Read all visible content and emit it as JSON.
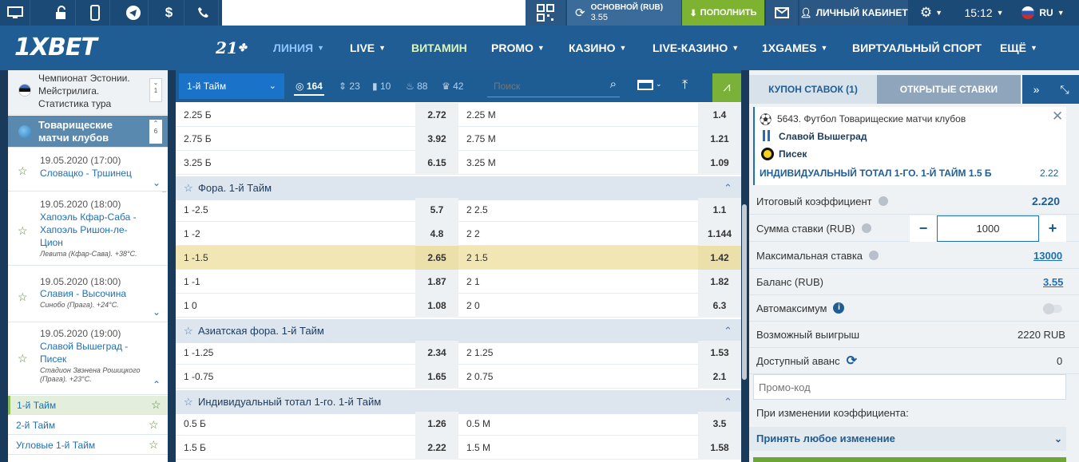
{
  "topbar": {
    "account_label": "ОСНОВНОЙ (RUB)",
    "account_amount": "3.55",
    "deposit": "ПОПОЛНИТЬ",
    "cabinet": "ЛИЧНЫЙ КАБИНЕТ",
    "time": "15:12",
    "lang": "RU"
  },
  "logo": "1XBET",
  "nav": {
    "n21": "21",
    "liniya": "ЛИНИЯ",
    "live": "LIVE",
    "vitamin": "ВИТАМИН",
    "promo": "PROMO",
    "casino": "КАЗИНО",
    "livecasino": "LIVE-КАЗИНО",
    "xgames": "1XGAMES",
    "virtual": "ВИРТУАЛЬНЫЙ СПОРТ",
    "more": "ЕЩЁ"
  },
  "left": {
    "top_title": "Чемпионат Эстонии. Мейстрилига. Статистика тура",
    "top_count": "1",
    "league": "Товарищеские матчи клубов",
    "league_count": "6",
    "matches": [
      {
        "time": "19.05.2020 (17:00)",
        "teams": "Словацко - Тршинец",
        "info": ""
      },
      {
        "time": "19.05.2020 (18:00)",
        "teams": "Хапоэль Кфар-Саба - Хапоэль Ришон-ле-Цион",
        "info": "Левита (Кфар-Сава). +38°C."
      },
      {
        "time": "19.05.2020 (18:00)",
        "teams": "Славия - Высочина",
        "info": "Синобо (Прага). +24°C."
      },
      {
        "time": "19.05.2020 (19:00)",
        "teams": "Славой Вышеград - Писек",
        "info": "Стадион Звэнена Рошицкого (Прага). +23°C."
      }
    ],
    "periods": [
      "1-й Тайм",
      "2-й Тайм",
      "Угловые 1-й Тайм"
    ]
  },
  "center": {
    "select": "1-й Тайм",
    "c164": "164",
    "c23": "23",
    "c10": "10",
    "c88": "88",
    "c42": "42",
    "search_placeholder": "Поиск",
    "rows_a": [
      [
        "2.25 Б",
        "2.72",
        "2.25 М",
        "1.4"
      ],
      [
        "2.75 Б",
        "3.92",
        "2.75 М",
        "1.21"
      ],
      [
        "3.25 Б",
        "6.15",
        "3.25 М",
        "1.09"
      ]
    ],
    "sec1": "Фора. 1-й Тайм",
    "rows_b": [
      [
        "1 -2.5",
        "5.7",
        "2 2.5",
        "1.1"
      ],
      [
        "1 -2",
        "4.8",
        "2 2",
        "1.144"
      ],
      [
        "1 -1.5",
        "2.65",
        "2 1.5",
        "1.42"
      ],
      [
        "1 -1",
        "1.87",
        "2 1",
        "1.82"
      ],
      [
        "1 0",
        "1.08",
        "2 0",
        "6.3"
      ]
    ],
    "sec2": "Азиатская фора. 1-й Тайм",
    "rows_c": [
      [
        "1 -1.25",
        "2.34",
        "2 1.25",
        "1.53"
      ],
      [
        "1 -0.75",
        "1.65",
        "2 0.75",
        "2.1"
      ]
    ],
    "sec3": "Индивидуальный тотал 1-го. 1-й Тайм",
    "rows_d": [
      [
        "0.5 Б",
        "1.26",
        "0.5 М",
        "3.5"
      ],
      [
        "1.5 Б",
        "2.22",
        "1.5 М",
        "1.58"
      ]
    ]
  },
  "coupon": {
    "tab1": "КУПОН СТАВОК (1)",
    "tab2": "ОТКРЫТЫЕ СТАВКИ",
    "event": "5643. Футбол Товарищеские матчи клубов",
    "team1": "Славой Вышеград",
    "team2": "Писек",
    "bet": "ИНДИВИДУАЛЬНЫЙ ТОТАЛ 1-ГО. 1-Й ТАЙМ  1.5 Б",
    "bet_odd": "2.22",
    "total_label": "Итоговый коэффициент",
    "total": "2.220",
    "stake_label": "Сумма ставки (RUB)",
    "stake": "1000",
    "max_label": "Максимальная ставка",
    "max": "13000",
    "balance_label": "Баланс (RUB)",
    "balance": "3.55",
    "auto_label": "Автомаксимум",
    "win_label": "Возможный выигрыш",
    "win": "2220 RUB",
    "adv_label": "Доступный аванс",
    "adv": "0",
    "promo_placeholder": "Промо-код",
    "change_label": "При изменении коэффициента:",
    "change_value": "Принять любое изменение"
  }
}
